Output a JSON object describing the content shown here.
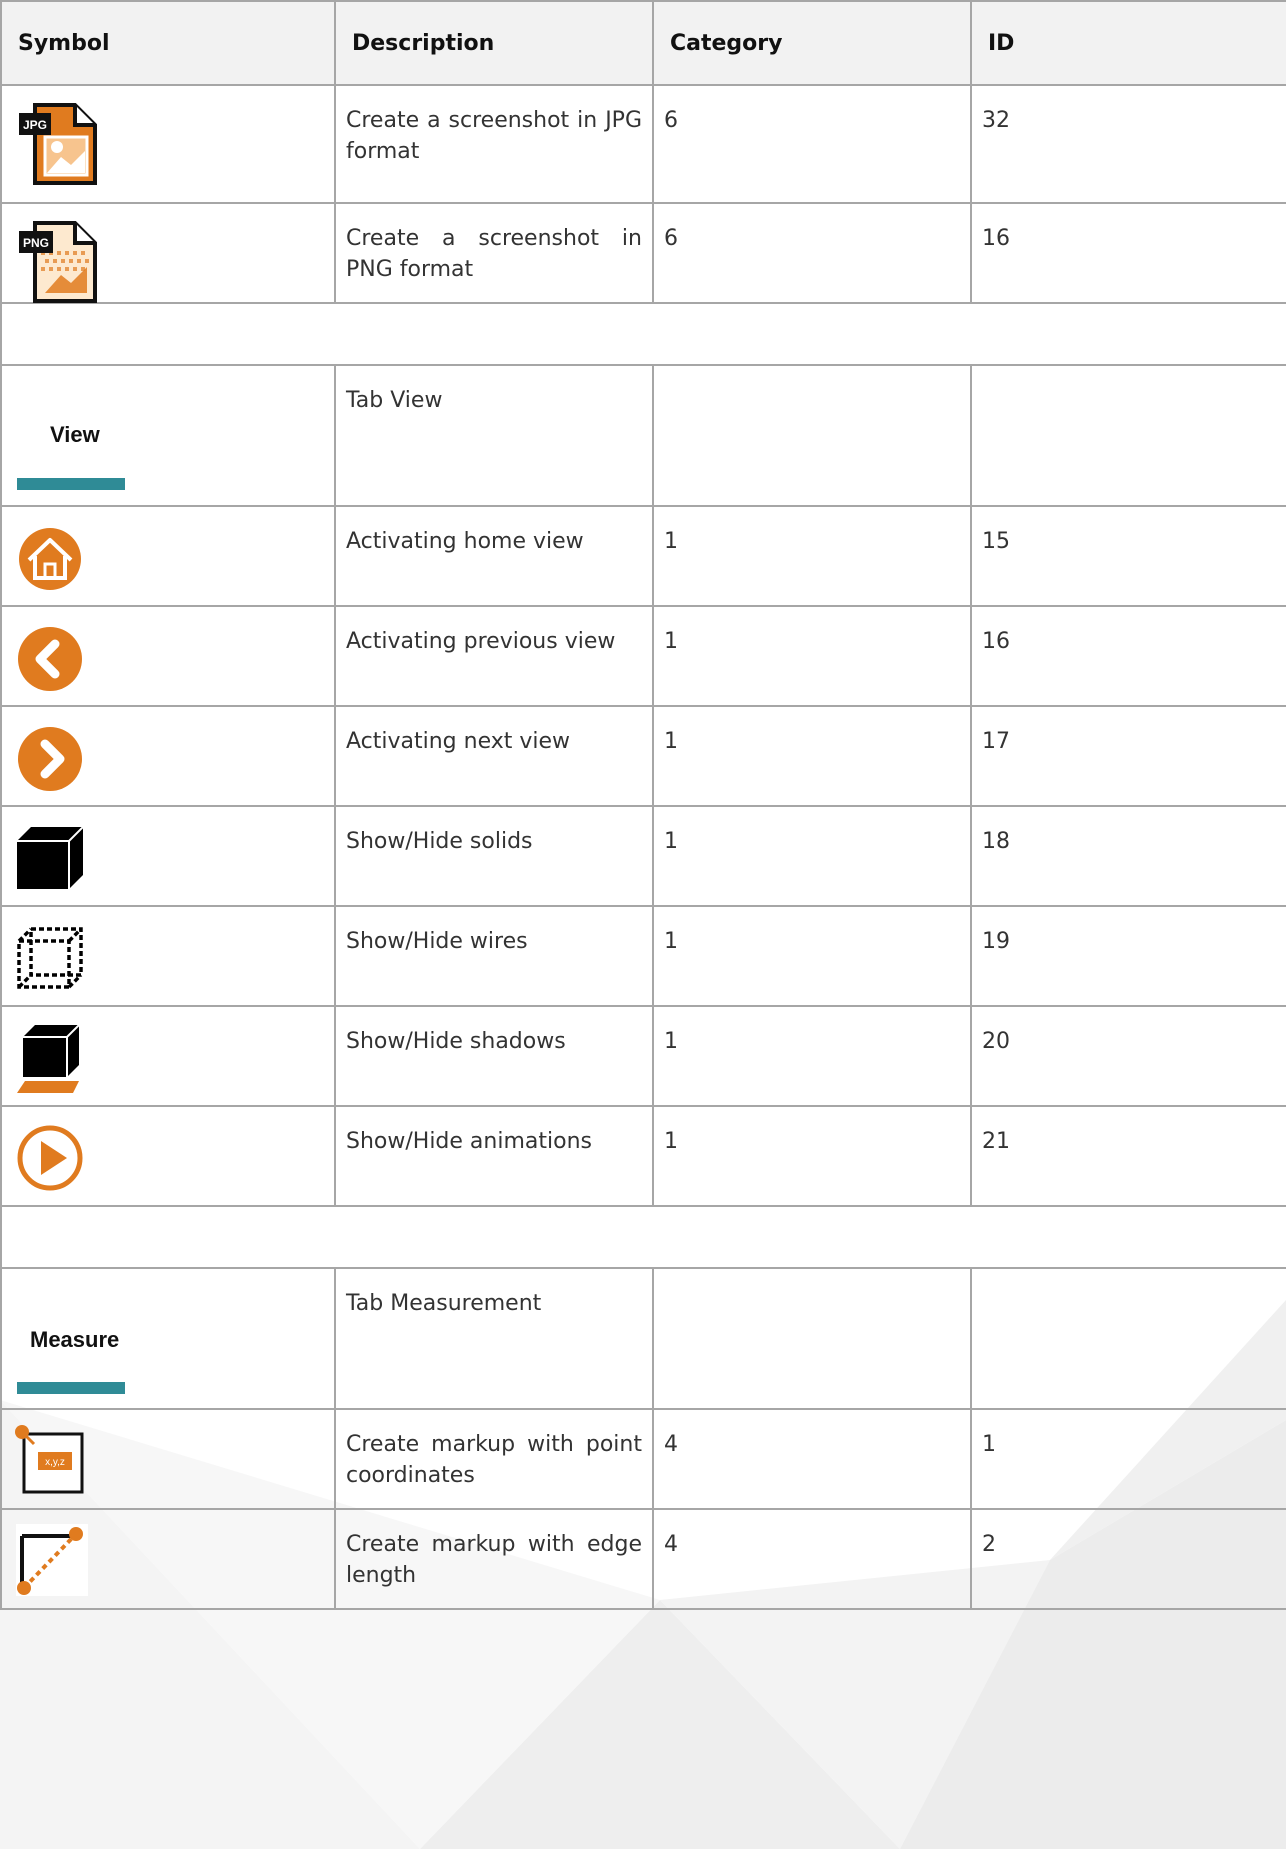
{
  "table": {
    "headers": [
      "Symbol",
      "Description",
      "Category",
      "ID"
    ],
    "rows": [
      {
        "description": "Create a screenshot in JPG format",
        "category": "6",
        "id": "32",
        "icon": "jpg-file-icon",
        "icon_text": "JPG"
      },
      {
        "description": "Create a screenshot in PNG format",
        "category": "6",
        "id": "16",
        "icon": "png-file-icon",
        "icon_text": "PNG"
      },
      {
        "description": "Tab View",
        "category": "",
        "id": "",
        "icon": "tab-view",
        "tab_label": "View"
      },
      {
        "description": "Activating home view",
        "category": "1",
        "id": "15",
        "icon": "home-icon"
      },
      {
        "description": "Activating previous view",
        "category": "1",
        "id": "16",
        "icon": "chevron-left-icon"
      },
      {
        "description": "Activating next view",
        "category": "1",
        "id": "17",
        "icon": "chevron-right-icon"
      },
      {
        "description": "Show/Hide solids",
        "category": "1",
        "id": "18",
        "icon": "solid-cube-icon"
      },
      {
        "description": "Show/Hide wires",
        "category": "1",
        "id": "19",
        "icon": "wire-cube-icon"
      },
      {
        "description": "Show/Hide shadows",
        "category": "1",
        "id": "20",
        "icon": "shadow-cube-icon"
      },
      {
        "description": "Show/Hide animations",
        "category": "1",
        "id": "21",
        "icon": "play-icon"
      },
      {
        "description": "Tab Measurement",
        "category": "",
        "id": "",
        "icon": "tab-measure",
        "tab_label": "Measure"
      },
      {
        "description": "Create markup with point coordinates",
        "category": "4",
        "id": "1",
        "icon": "point-coordinates-icon",
        "icon_text": "x,y,z"
      },
      {
        "description": "Create markup with edge length",
        "category": "4",
        "id": "2",
        "icon": "edge-length-icon"
      }
    ]
  },
  "colors": {
    "orange": "#e07b1f",
    "teal": "#2f8b96",
    "border": "#a6a6a6",
    "header_bg": "#f2f2f2"
  }
}
